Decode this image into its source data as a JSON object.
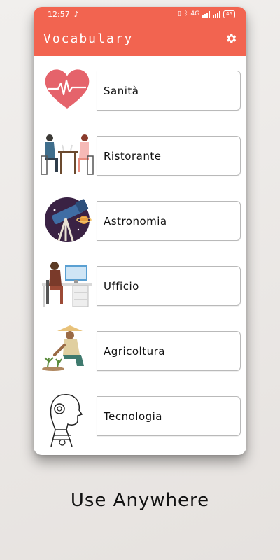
{
  "status": {
    "time": "12:57",
    "network": "4G",
    "battery": "46"
  },
  "app": {
    "title": "Vocabulary"
  },
  "categories": [
    {
      "label": "Sanità",
      "icon": "heart-pulse-icon"
    },
    {
      "label": "Ristorante",
      "icon": "restaurant-couple-icon"
    },
    {
      "label": "Astronomia",
      "icon": "telescope-icon"
    },
    {
      "label": "Ufficio",
      "icon": "office-desk-icon"
    },
    {
      "label": "Agricoltura",
      "icon": "farmer-icon"
    },
    {
      "label": "Tecnologia",
      "icon": "robot-head-icon"
    }
  ],
  "tagline": "Use Anywhere",
  "colors": {
    "accent": "#f26450",
    "heart": "#e5636b"
  }
}
